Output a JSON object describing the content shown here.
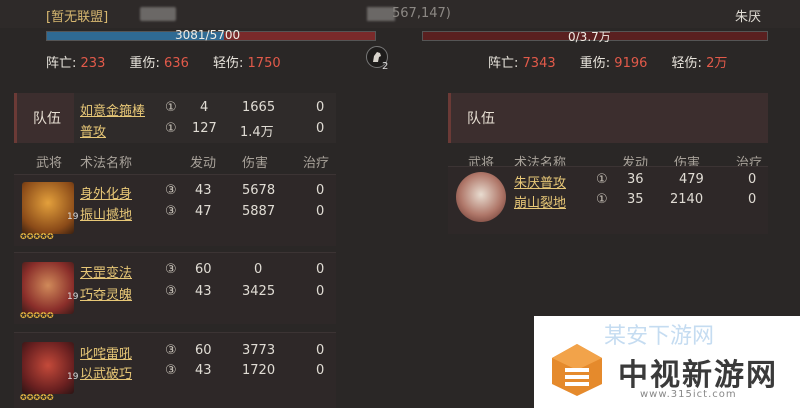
{
  "header": {
    "alliance": "[暂无联盟]",
    "coord": "567,147)",
    "enemy_name": "朱厌"
  },
  "hp": {
    "left_text": "3081/5700",
    "left_fraction": 0.54,
    "right_text": "0/3.7万",
    "right_fraction": 0
  },
  "stats_left": {
    "dead_label": "阵亡:",
    "dead": "233",
    "heavy_label": "重伤:",
    "heavy": "636",
    "light_label": "轻伤:",
    "light": "1750"
  },
  "stats_right": {
    "dead_label": "阵亡:",
    "dead": "7343",
    "heavy_label": "重伤:",
    "heavy": "9196",
    "light_label": "轻伤:",
    "light": "2万"
  },
  "horse": {
    "count": "2"
  },
  "team_label": "队伍",
  "left_team_skills": [
    {
      "name": "如意金箍棒",
      "level": "①",
      "activations": "4",
      "damage": "1665",
      "heal": "0"
    },
    {
      "name": "普攻",
      "level": "①",
      "activations": "127",
      "damage": "1.4万",
      "heal": "0"
    }
  ],
  "columns": {
    "general": "武将",
    "skill": "术法名称",
    "activations": "发动",
    "damage": "伤害",
    "heal": "治疗"
  },
  "left_generals": [
    {
      "level": "19",
      "skills": [
        {
          "name": "身外化身",
          "level": "③",
          "activations": "43",
          "damage": "5678",
          "heal": "0"
        },
        {
          "name": "振山撼地",
          "level": "③",
          "activations": "47",
          "damage": "5887",
          "heal": "0"
        }
      ]
    },
    {
      "level": "19",
      "skills": [
        {
          "name": "天罡变法",
          "level": "③",
          "activations": "60",
          "damage": "0",
          "heal": "0"
        },
        {
          "name": "巧夺灵魄",
          "level": "③",
          "activations": "43",
          "damage": "3425",
          "heal": "0"
        }
      ]
    },
    {
      "level": "19",
      "skills": [
        {
          "name": "叱咤雷吼",
          "level": "③",
          "activations": "60",
          "damage": "3773",
          "heal": "0"
        },
        {
          "name": "以武破巧",
          "level": "③",
          "activations": "43",
          "damage": "1720",
          "heal": "0"
        }
      ]
    }
  ],
  "right_general": {
    "skills": [
      {
        "name": "朱厌普攻",
        "level": "①",
        "activations": "36",
        "damage": "479",
        "heal": "0"
      },
      {
        "name": "崩山裂地",
        "level": "①",
        "activations": "35",
        "damage": "2140",
        "heal": "0"
      }
    ]
  },
  "watermark": {
    "title": "中视新游网",
    "url": "www.315ict.com",
    "faded": "某安下游网"
  },
  "colors": {
    "skill_gold": "#e7c777",
    "loss_red": "#e25a4a",
    "hp_blue": "#2f6a93"
  }
}
